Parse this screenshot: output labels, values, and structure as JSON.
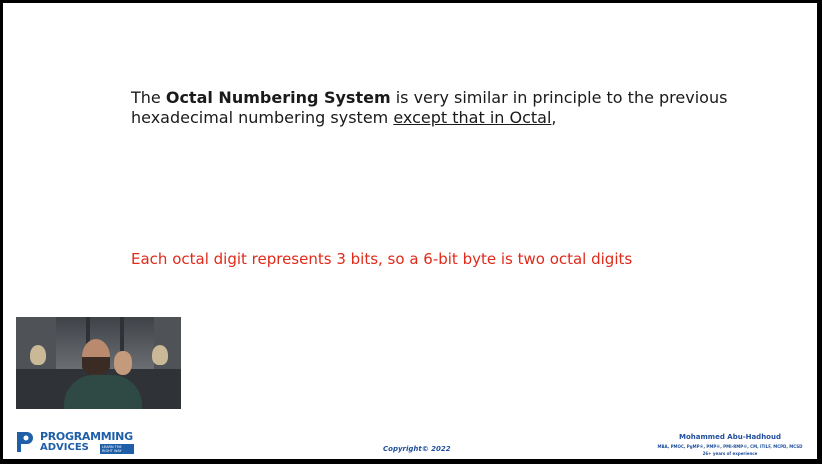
{
  "slide": {
    "paragraph": {
      "prefix": "The ",
      "bold_term": "Octal Numbering System",
      "middle": " is very similar in principle to the previous hexadecimal numbering system ",
      "underlined": "except that in Octal",
      "suffix": ","
    },
    "note": "Each octal digit represents 3 bits, so a 6-bit byte is two octal digits"
  },
  "footer": {
    "logo_title": "PROGRAMMING",
    "logo_sub": "ADVICES",
    "logo_tagline": "LEARN THE RIGHT WAY",
    "copyright": "Copyright© 2022",
    "author_name": "Mohammed Abu-Hadhoud",
    "author_credentials": "MBA, PMOC, PgMP®, PMP®, PMI-RMP®, CM, ITILF, MCPD, MCSD",
    "author_experience": "26+ years of experience"
  },
  "colors": {
    "text": "#1a1a1a",
    "note_red": "#e02a1a",
    "brand_blue": "#1f5fa8"
  }
}
